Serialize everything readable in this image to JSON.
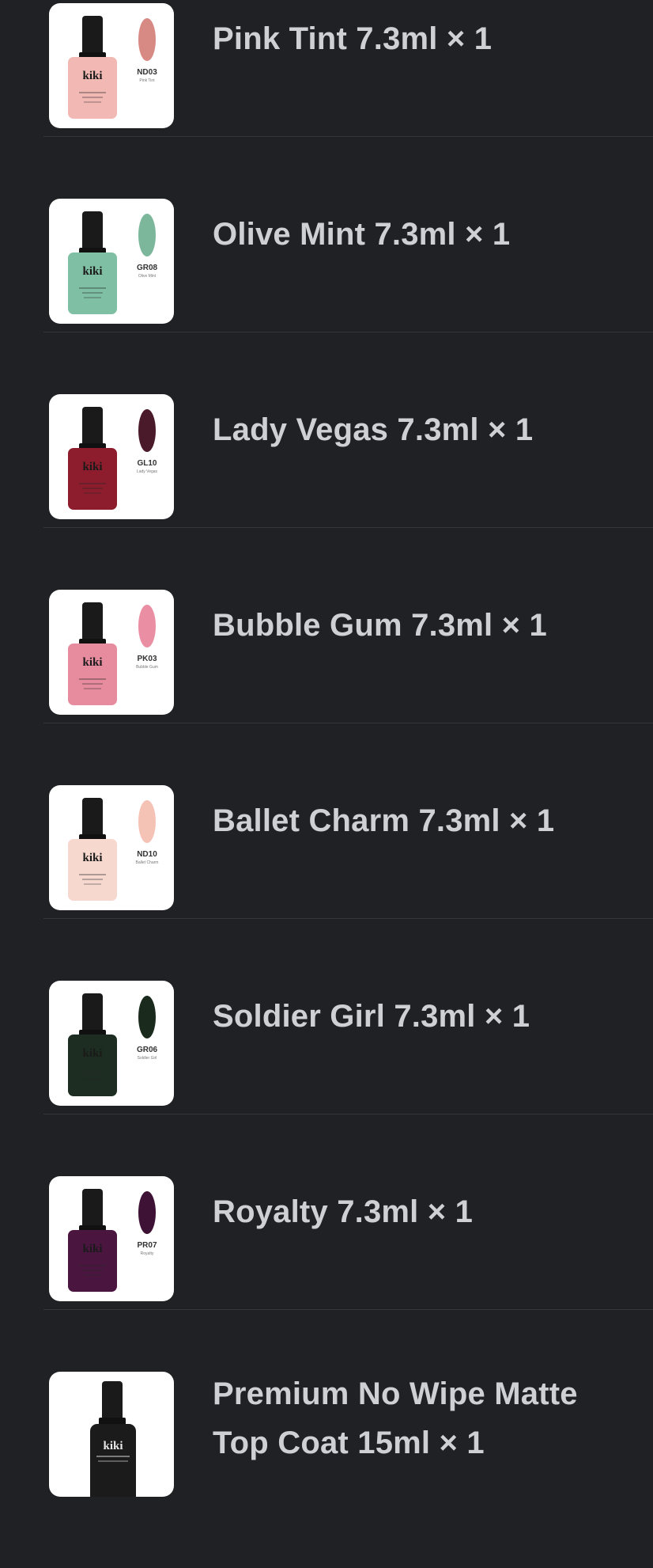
{
  "order_items": [
    {
      "name": "Pink Tint 7.3ml × 1",
      "code": "ND03",
      "shade": "Pink Tint",
      "brand": "kiki",
      "bottle_color": "#f2b8b3",
      "swatch_color": "#d78a84"
    },
    {
      "name": "Olive Mint 7.3ml × 1",
      "code": "GR08",
      "shade": "Olive Mint",
      "brand": "kiki",
      "bottle_color": "#7fbfa3",
      "swatch_color": "#7cb79c"
    },
    {
      "name": "Lady Vegas 7.3ml × 1",
      "code": "GL10",
      "shade": "Lady Vegas",
      "brand": "kiki",
      "bottle_color": "#8d1c2c",
      "swatch_color": "#4a1a2a"
    },
    {
      "name": "Bubble Gum 7.3ml × 1",
      "code": "PK03",
      "shade": "Bubble Gum",
      "brand": "kiki",
      "bottle_color": "#e78b9f",
      "swatch_color": "#ea8fa3"
    },
    {
      "name": "Ballet Charm 7.3ml × 1",
      "code": "ND10",
      "shade": "Ballet Charm",
      "brand": "kiki",
      "bottle_color": "#f6d8cf",
      "swatch_color": "#f5c2b6"
    },
    {
      "name": "Soldier Girl 7.3ml × 1",
      "code": "GR06",
      "shade": "Soldier Girl",
      "brand": "kiki",
      "bottle_color": "#1d2d21",
      "swatch_color": "#1a2a1c"
    },
    {
      "name": "Royalty 7.3ml × 1",
      "code": "PR07",
      "shade": "Royalty",
      "brand": "kiki",
      "bottle_color": "#4a1640",
      "swatch_color": "#3d1235"
    },
    {
      "name": "Premium No Wipe Matte Top Coat 15ml × 1",
      "code": "",
      "shade": "",
      "brand": "kiki",
      "bottle_color": "#1b1b1b",
      "swatch_color": ""
    }
  ]
}
